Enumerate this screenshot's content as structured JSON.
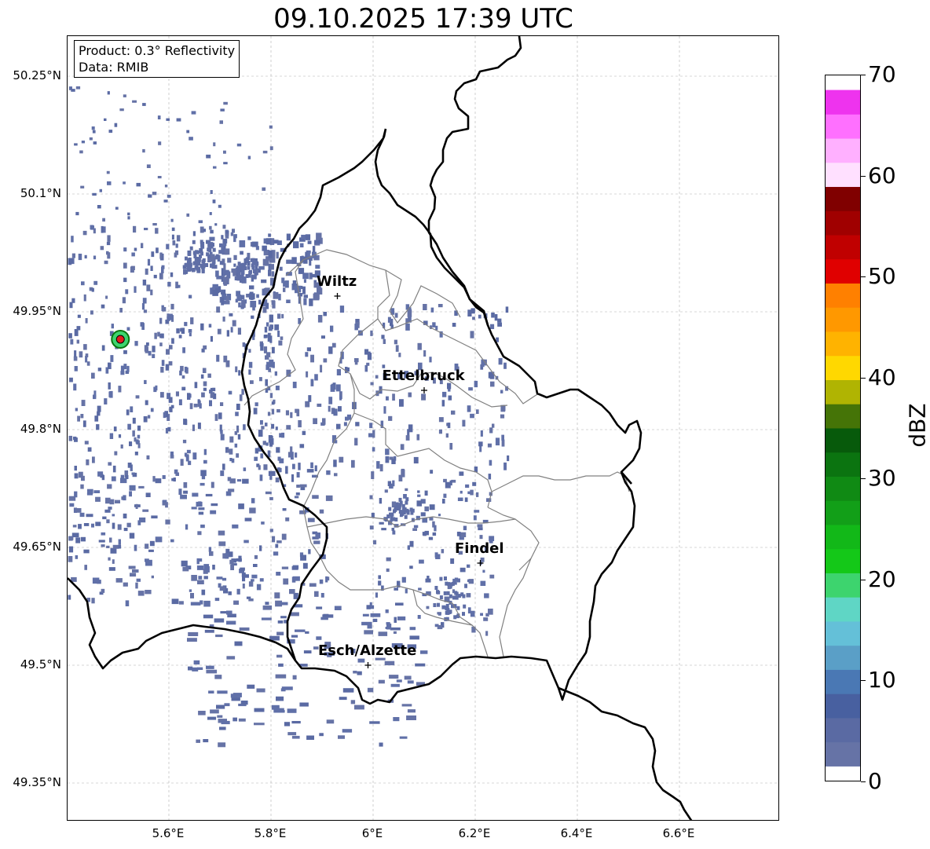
{
  "title": "09.10.2025 17:39 UTC",
  "info": {
    "product": "Product: 0.3° Reflectivity",
    "data": "Data: RMIB"
  },
  "map": {
    "lat_labels": [
      "50.25°N",
      "50.1°N",
      "49.95°N",
      "49.8°N",
      "49.65°N",
      "49.5°N",
      "49.35°N"
    ],
    "lon_labels": [
      "5.6°E",
      "5.8°E",
      "6°E",
      "6.2°E",
      "6.4°E",
      "6.6°E"
    ],
    "cities": [
      {
        "name": "Wiltz",
        "lon": 5.93,
        "lat": 49.97
      },
      {
        "name": "Ettelbruck",
        "lon": 6.1,
        "lat": 49.85
      },
      {
        "name": "Findel",
        "lon": 6.21,
        "lat": 49.63
      },
      {
        "name": "Esch/Alzette",
        "lon": 5.99,
        "lat": 49.5
      }
    ],
    "radar_site": {
      "lon": 5.505,
      "lat": 49.915,
      "marker_color": "#e31a1c"
    },
    "border_color": "#000000",
    "canton_color": "#808080"
  },
  "colorbar": {
    "unit": "dBZ",
    "min": 0,
    "max": 70,
    "ticks": [
      "0",
      "10",
      "20",
      "30",
      "40",
      "50",
      "60",
      "70"
    ],
    "colors": [
      "#6673a6",
      "#5a6aa3",
      "#4860a0",
      "#4a78b4",
      "#5a9fc7",
      "#64c0d8",
      "#5fd6c5",
      "#3dd46e",
      "#14c818",
      "#12b818",
      "#129f18",
      "#108a14",
      "#0b7410",
      "#075a0b",
      "#457407",
      "#b0b402",
      "#ffd800",
      "#ffb300",
      "#ff9800",
      "#ff8000",
      "#e00000",
      "#c00000",
      "#a00000",
      "#800000",
      "#ffe0ff",
      "#ffb0ff",
      "#ff70ff",
      "#ee33ee"
    ]
  }
}
